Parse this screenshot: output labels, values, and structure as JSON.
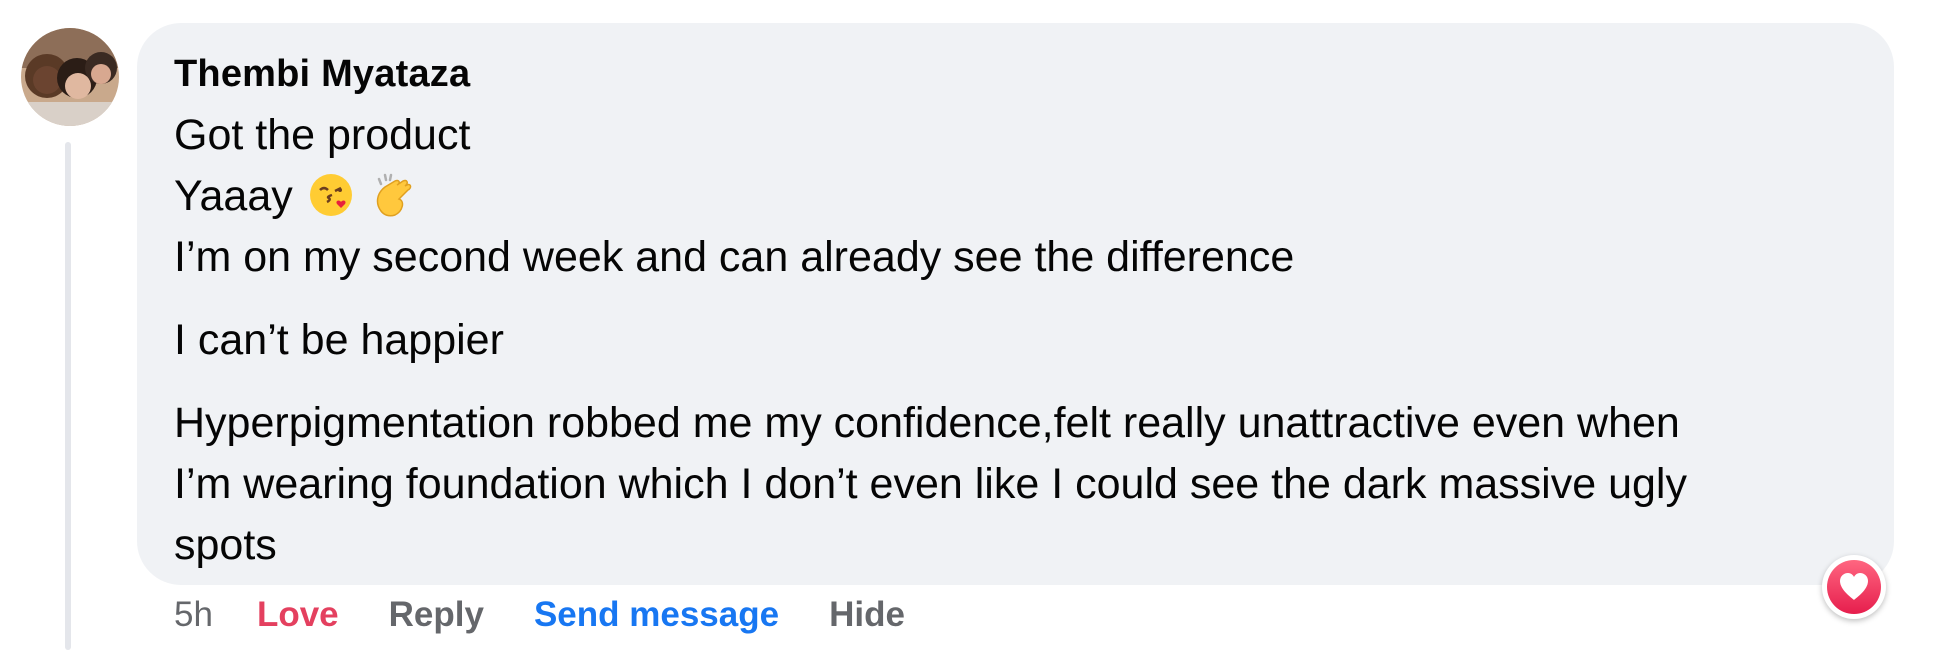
{
  "comment": {
    "author": "Thembi Myataza",
    "lines": [
      "Got the product",
      "Yaaay",
      "I’m on my second week and can already see the difference"
    ],
    "paragraph_2": "I can’t be happier",
    "paragraph_3_lines": [
      "Hyperpigmentation robbed me my confidence,felt really unattractive even when",
      "I’m wearing foundation which I don’t even like I could see the dark massive ugly",
      "spots"
    ],
    "emojis": [
      "kiss-emoji",
      "clapping-hands-emoji"
    ]
  },
  "actions": {
    "time": "5h",
    "love": "Love",
    "reply": "Reply",
    "send_message": "Send message",
    "hide": "Hide"
  },
  "reaction": {
    "icon": "heart-icon",
    "color": "#e41e3f"
  },
  "colors": {
    "bubble": "#f0f2f5",
    "love": "#e4405f",
    "link": "#1877f2",
    "muted": "#65676b"
  }
}
